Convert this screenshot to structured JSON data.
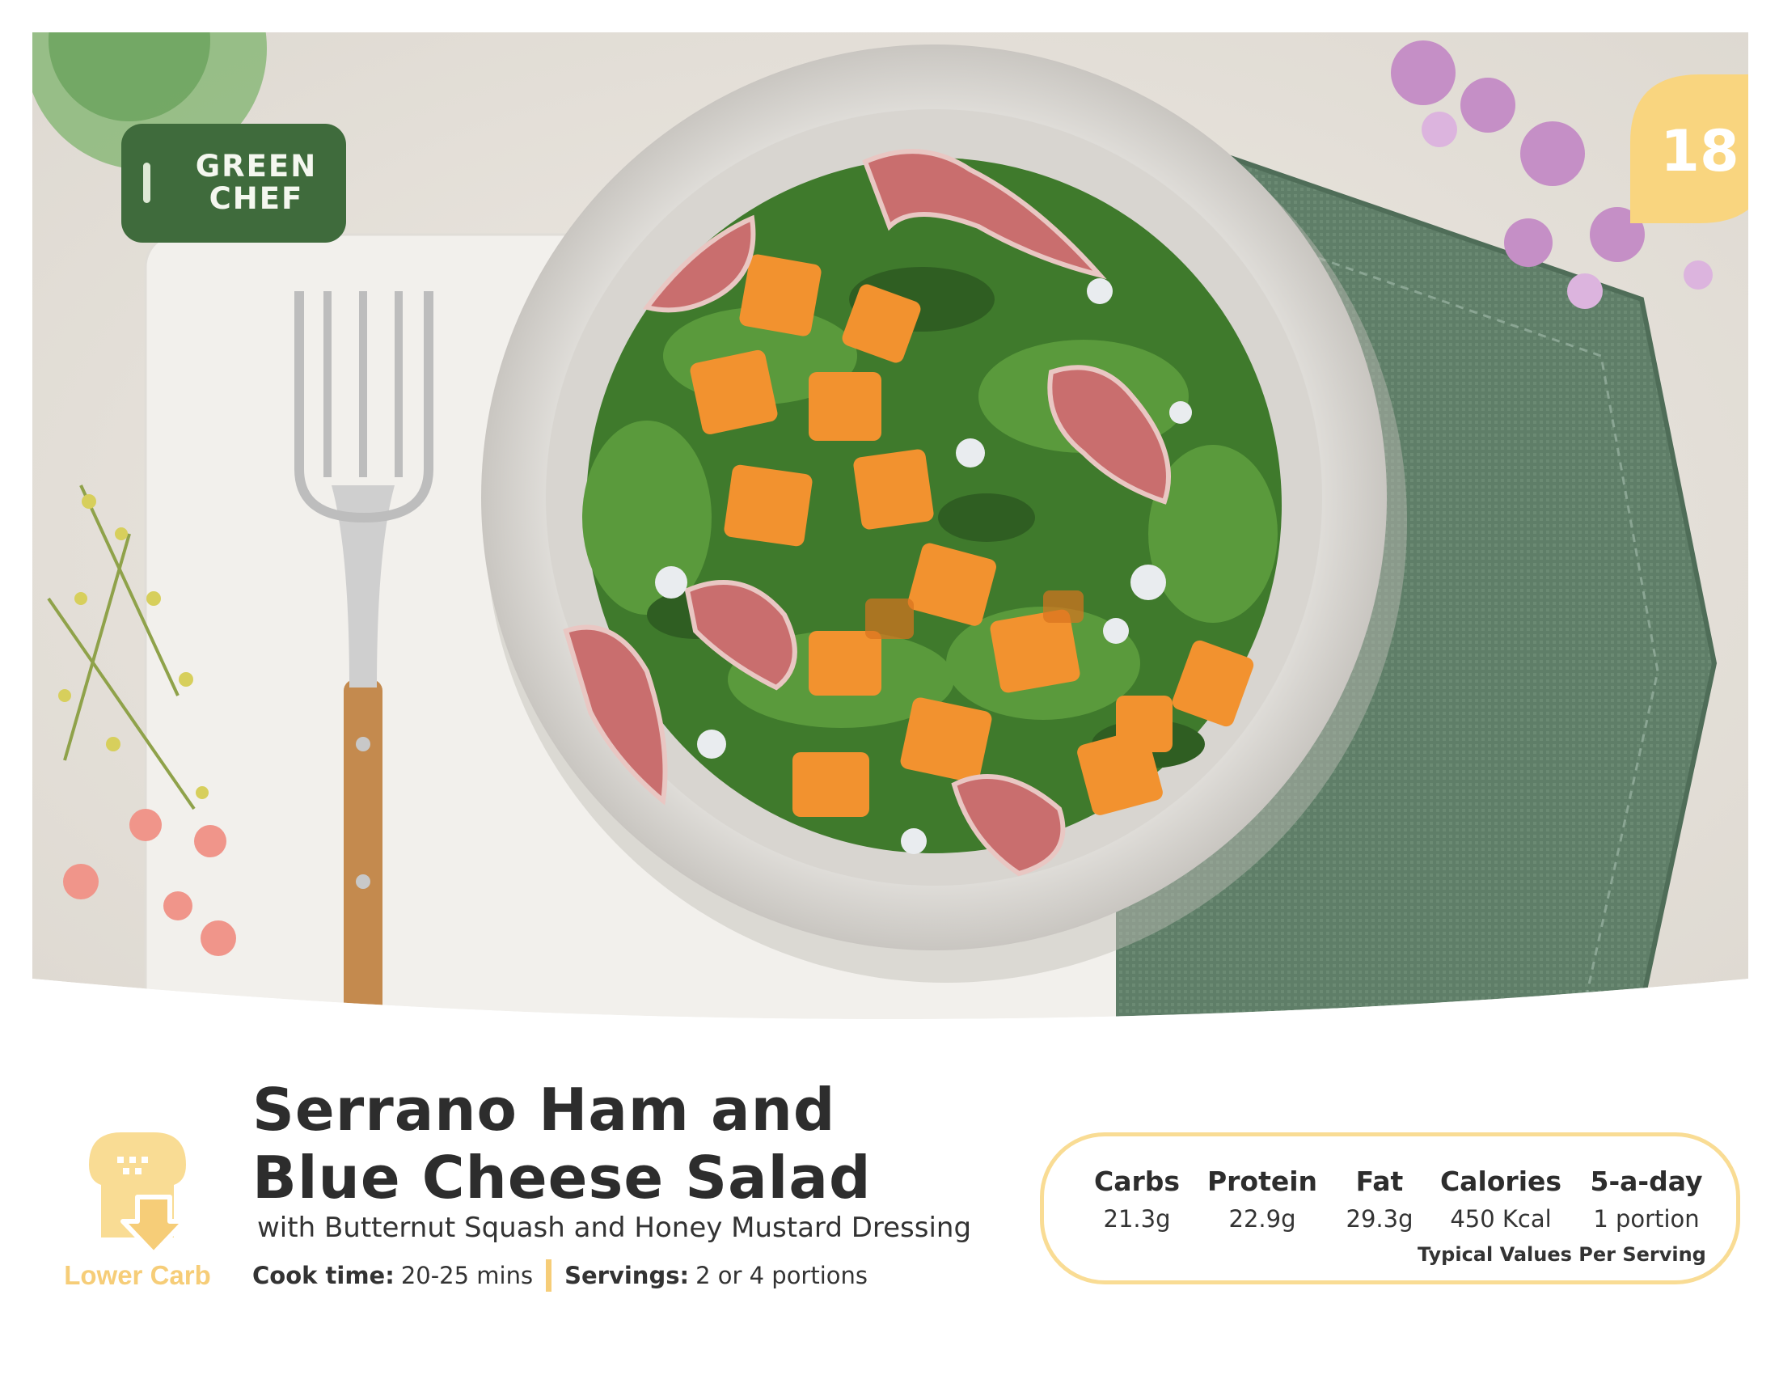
{
  "brand": {
    "logo_line1": "GREEN",
    "logo_line2": "CHEF"
  },
  "page_badge": {
    "number": "18",
    "color": "#f9d57f"
  },
  "diet_tag": {
    "label": "Lower Carb",
    "icon": "bread-down-arrow-icon",
    "color": "#f6cd78"
  },
  "recipe": {
    "title_line1": "Serrano Ham and",
    "title_line2": "Blue Cheese Salad",
    "subtitle": "with Butternut Squash and Honey Mustard Dressing"
  },
  "meta": {
    "cook_time_label": "Cook time:",
    "cook_time_value": "20-25 mins",
    "servings_label": "Servings:",
    "servings_value": "2 or 4 portions"
  },
  "nutrition": {
    "columns": [
      {
        "label": "Carbs",
        "value": "21.3g"
      },
      {
        "label": "Protein",
        "value": "22.9g"
      },
      {
        "label": "Fat",
        "value": "29.3g"
      },
      {
        "label": "Calories",
        "value": "450 Kcal"
      },
      {
        "label": "5-a-day",
        "value": "1 portion"
      }
    ],
    "note": "Typical Values Per Serving"
  },
  "colors": {
    "brand_green": "#3f6b3c",
    "accent_yellow": "#f9dc94"
  }
}
